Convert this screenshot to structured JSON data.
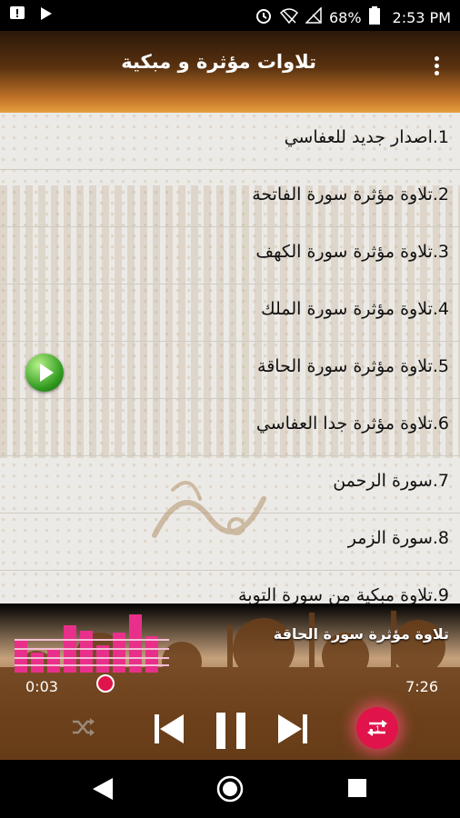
{
  "status_bar": {
    "battery": "68%",
    "time": "2:53 PM"
  },
  "app_bar": {
    "title": "تلاوات مؤثرة و مبكية"
  },
  "list": {
    "items": [
      {
        "label": "1.اصدار جديد للعفاسي"
      },
      {
        "label": "2.تلاوة مؤثرة سورة الفاتحة"
      },
      {
        "label": "3.تلاوة مؤثرة سورة الكهف"
      },
      {
        "label": "4.تلاوة مؤثرة سورة الملك"
      },
      {
        "label": "5.تلاوة مؤثرة سورة الحاقة",
        "playing": true
      },
      {
        "label": "6.تلاوة مؤثرة جدا العفاسي"
      },
      {
        "label": "7.سورة الرحمن"
      },
      {
        "label": "8.سورة الزمر"
      },
      {
        "label": "9.تلاوة مبكية من سورة التوبة"
      }
    ]
  },
  "player": {
    "now_playing": "تلاوة مؤثرة سورة الحاقة",
    "elapsed": "0:03",
    "duration": "7:26",
    "accent_color": "#e0144a"
  },
  "icons": {
    "status_left": [
      "notification-alert-icon",
      "play-store-icon"
    ],
    "status_right": [
      "alarm-icon",
      "wifi-icon",
      "signal-icon",
      "battery-icon"
    ],
    "controls": [
      "shuffle-icon",
      "previous-icon",
      "pause-icon",
      "next-icon",
      "repeat-one-icon"
    ],
    "nav": [
      "back-icon",
      "home-icon",
      "recents-icon"
    ]
  }
}
